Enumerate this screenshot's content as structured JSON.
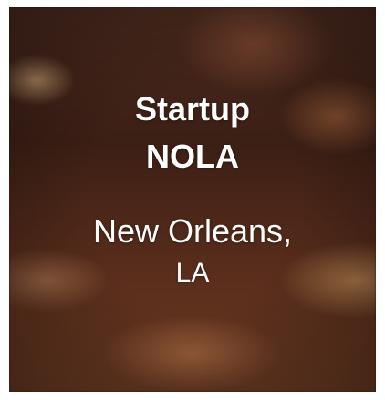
{
  "card": {
    "title_line1": "Startup",
    "title_line2": "NOLA",
    "subtitle_line1": "New Orleans,",
    "subtitle_line2": "LA"
  },
  "colors": {
    "text": "#ffffff",
    "background": "#3a1d14"
  }
}
